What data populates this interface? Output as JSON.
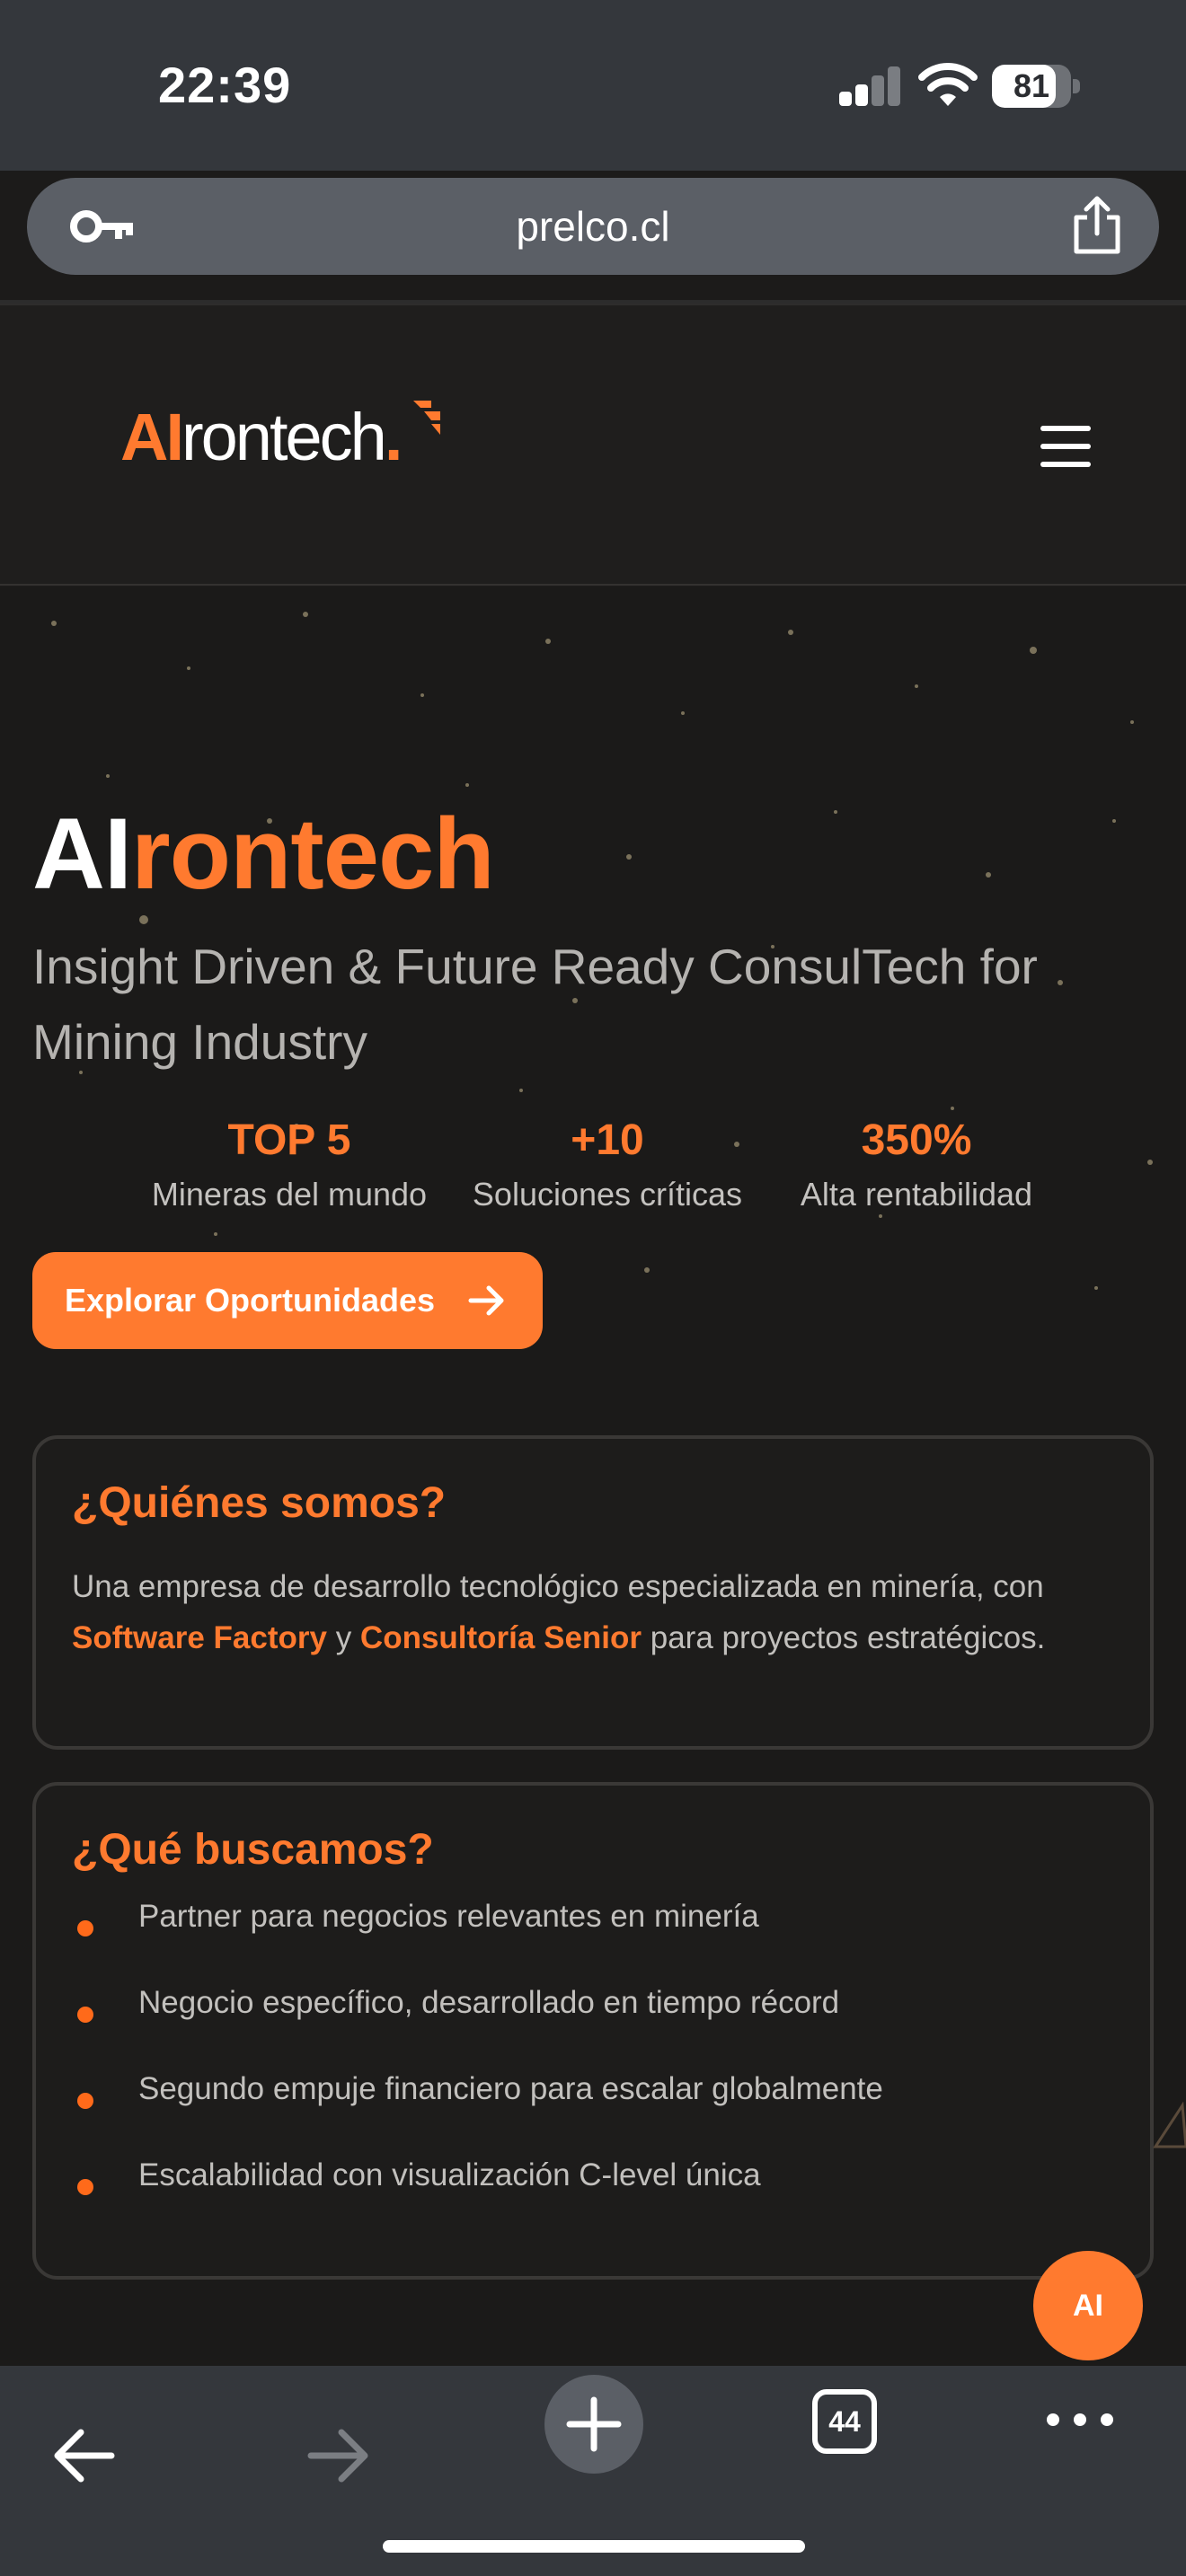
{
  "status_bar": {
    "time": "22:39",
    "battery": "81",
    "battery_level": 0.81,
    "signal_bars": 2
  },
  "browser": {
    "url": "prelco.cl",
    "tab_count": "44"
  },
  "site": {
    "logo_ai": "AI",
    "logo_rest": "rontech",
    "logo_dot": "."
  },
  "hero": {
    "title_white": "AI",
    "title_orange": "rontech",
    "subtitle": "Insight Driven & Future Ready ConsulTech for Mining Industry",
    "stats": [
      {
        "value": "TOP 5",
        "label": "Mineras del mundo"
      },
      {
        "value": "+10",
        "label": "Soluciones críticas"
      },
      {
        "value": "350%",
        "label": "Alta rentabilidad"
      }
    ],
    "cta_label": "Explorar Oportunidades"
  },
  "about": {
    "title": "¿Quiénes somos?",
    "text_1": "Una empresa de desarrollo tecnológico especializada en minería, con ",
    "highlight_1": "Software Factory",
    "text_2": " y ",
    "highlight_2": "Consultoría Senior",
    "text_3": " para proyectos estratégicos."
  },
  "seeking": {
    "title": "¿Qué buscamos?",
    "items": [
      "Partner para negocios relevantes en minería",
      "Negocio específico, desarrollado en tiempo récord",
      "Segundo empuje financiero para escalar globalmente",
      "Escalabilidad con visualización C-level única"
    ]
  },
  "chat_fab": {
    "label": "AI"
  },
  "colors": {
    "accent": "#ff7a2f",
    "background": "#1b1a19",
    "browser_chrome": "#34373c"
  }
}
